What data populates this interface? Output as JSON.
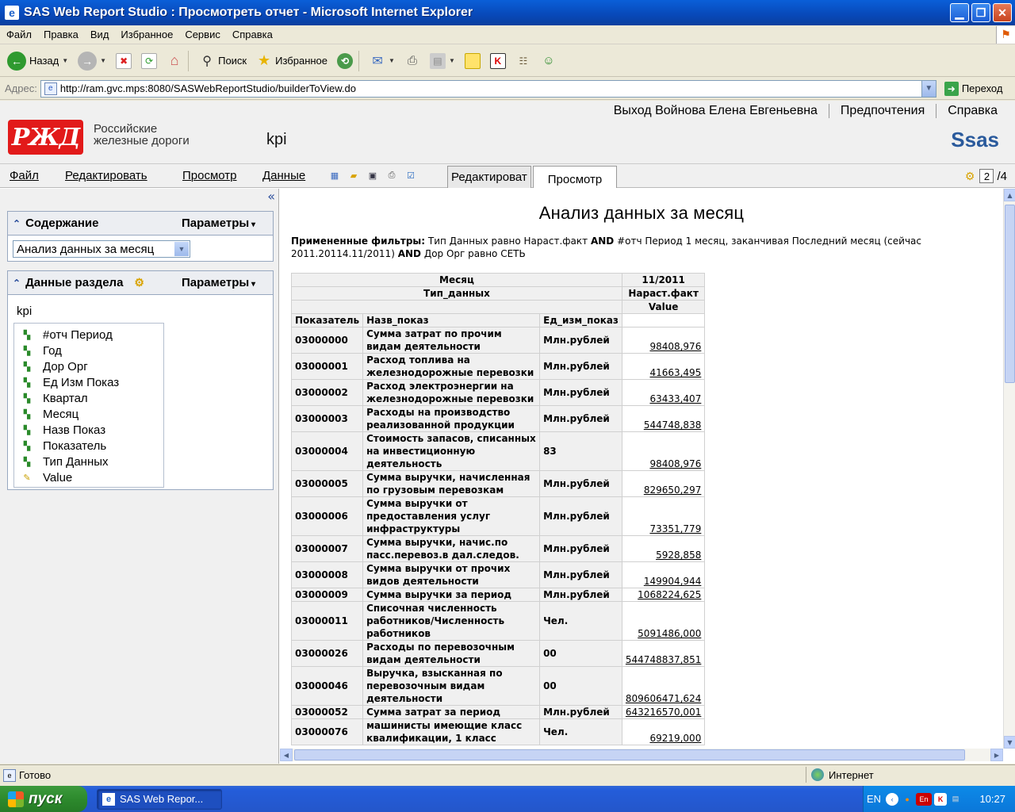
{
  "window": {
    "title": "SAS Web Report Studio : Просмотреть отчет - Microsoft Internet Explorer"
  },
  "menubar": [
    "Файл",
    "Правка",
    "Вид",
    "Избранное",
    "Сервис",
    "Справка"
  ],
  "toolbar": {
    "back_label": "Назад",
    "search_label": "Поиск",
    "favorites_label": "Избранное"
  },
  "address": {
    "label": "Адрес:",
    "url": "http://ram.gvc.mps:8080/SASWebReportStudio/builderToView.do",
    "go_label": "Переход"
  },
  "app": {
    "links": [
      "Выход Войнова Елена Евгеньевна",
      "Предпочтения",
      "Справка"
    ],
    "logo_text": "РЖД",
    "company_line1": "Российские",
    "company_line2": "железные дороги",
    "report_name": "kpi",
    "sas_logo": "Ssas",
    "menu": [
      "Файл",
      "Редактировать",
      "Просмотр",
      "Данные"
    ],
    "tabs": [
      "Редактироват",
      "Просмотр"
    ],
    "page_current": "2",
    "page_total": "/4"
  },
  "left_panel": {
    "collapse_icon": "«",
    "content_panel": {
      "title": "Содержание",
      "params_label": "Параметры",
      "select_value": "Анализ данных за месяц"
    },
    "section_panel": {
      "title": "Данные раздела",
      "params_label": "Параметры",
      "source_label": "kpi",
      "items": [
        {
          "label": "#отч Период",
          "icon": "category-icon"
        },
        {
          "label": "Год",
          "icon": "category-icon"
        },
        {
          "label": "Дор Орг",
          "icon": "category-icon"
        },
        {
          "label": "Ед Изм Показ",
          "icon": "category-icon"
        },
        {
          "label": "Квартал",
          "icon": "category-icon"
        },
        {
          "label": "Месяц",
          "icon": "category-icon"
        },
        {
          "label": "Назв Показ",
          "icon": "category-icon"
        },
        {
          "label": "Показатель",
          "icon": "category-icon"
        },
        {
          "label": "Тип Данных",
          "icon": "category-icon"
        },
        {
          "label": "Value",
          "icon": "measure-icon"
        }
      ]
    }
  },
  "report": {
    "title": "Анализ данных за месяц",
    "filters_label": "Примененные фильтры:",
    "filters_text_1": "Тип Данных равно Нараст.факт",
    "and1": "AND",
    "filters_text_2": "#отч Период 1 месяц, заканчивая Последний месяц (сейчас 2011.20114.11/2011)",
    "and2": "AND",
    "filters_text_3": "Дор Орг равно СЕТЬ",
    "table": {
      "hdr_month": "Месяц",
      "hdr_month_value": "11/2011",
      "hdr_type": "Тип_данных",
      "hdr_type_value": "Нараст.факт",
      "hdr_measure": "Value",
      "col_code": "Показатель",
      "col_name": "Назв_показ",
      "col_unit": "Ед_изм_показ",
      "rows": [
        {
          "code": "03000000",
          "name": "Сумма затрат по прочим видам деятельности",
          "unit": "Млн.рублей",
          "value": "98408,976"
        },
        {
          "code": "03000001",
          "name": "Расход топлива на железнодорожные перевозки",
          "unit": "Млн.рублей",
          "value": "41663,495"
        },
        {
          "code": "03000002",
          "name": "Расход электроэнергии на железнодорожные перевозки",
          "unit": "Млн.рублей",
          "value": "63433,407"
        },
        {
          "code": "03000003",
          "name": "Расходы на производство реализованной продукции",
          "unit": "Млн.рублей",
          "value": "544748,838"
        },
        {
          "code": "03000004",
          "name": "Стоимость запасов, списанных на инвестиционную деятельность",
          "unit": "83",
          "value": "98408,976"
        },
        {
          "code": "03000005",
          "name": "Сумма выручки, начисленная по грузовым перевозкам",
          "unit": "Млн.рублей",
          "value": "829650,297"
        },
        {
          "code": "03000006",
          "name": "Сумма выручки от предоставления услуг инфраструктуры",
          "unit": "Млн.рублей",
          "value": "73351,779"
        },
        {
          "code": "03000007",
          "name": "Сумма выручки, начис.по пасс.перевоз.в дал.следов.",
          "unit": "Млн.рублей",
          "value": "5928,858"
        },
        {
          "code": "03000008",
          "name": "Сумма выручки от прочих видов деятельности",
          "unit": "Млн.рублей",
          "value": "149904,944"
        },
        {
          "code": "03000009",
          "name": "Сумма выручки за период",
          "unit": "Млн.рублей",
          "value": "1068224,625"
        },
        {
          "code": "03000011",
          "name": "Списочная численность работников/Численность работников",
          "unit": "Чел.",
          "value": "5091486,000"
        },
        {
          "code": "03000026",
          "name": "Расходы по перевозочным видам деятельности",
          "unit": "00",
          "value": "544748837,851"
        },
        {
          "code": "03000046",
          "name": "Выручка, взысканная по перевозочным видам деятельности",
          "unit": "00",
          "value": "809606471,624"
        },
        {
          "code": "03000052",
          "name": "Сумма затрат за период",
          "unit": "Млн.рублей",
          "value": "643216570,001"
        },
        {
          "code": "03000076",
          "name": "машинисты имеющие класс квалификации, 1 класс",
          "unit": "Чел.",
          "value": "69219,000"
        }
      ]
    }
  },
  "statusbar": {
    "status": "Готово",
    "zone": "Интернет"
  },
  "taskbar": {
    "start_label": "пуск",
    "task_label": "SAS Web Repor...",
    "lang": "EN",
    "tray_lang": "En",
    "clock": "10:27"
  }
}
